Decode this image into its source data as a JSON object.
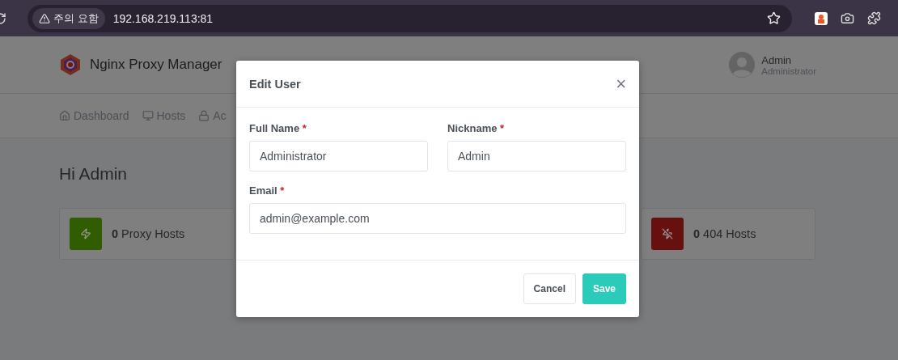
{
  "browser": {
    "security_chip": "주의 요함",
    "url": "192.168.219.113:81"
  },
  "header": {
    "brand": "Nginx Proxy Manager",
    "user": {
      "name": "Admin",
      "role": "Administrator"
    }
  },
  "nav": [
    {
      "label": "Dashboard"
    },
    {
      "label": "Hosts"
    },
    {
      "label": "Ac"
    }
  ],
  "greeting": "Hi Admin",
  "stats": [
    {
      "count": "0",
      "label": "Proxy Hosts",
      "color": "#2f5d00"
    },
    {
      "count": "0",
      "label": "404 Hosts",
      "color": "#671010"
    }
  ],
  "modal": {
    "title": "Edit User",
    "close": "×",
    "fields": [
      {
        "label": "Full Name",
        "required_mark": "*",
        "value": "Administrator"
      },
      {
        "label": "Nickname",
        "required_mark": "*",
        "value": "Admin"
      },
      {
        "label": "Email",
        "required_mark": "*",
        "value": "admin@example.com"
      }
    ],
    "buttons": [
      {
        "label": "Cancel",
        "kind": "secondary"
      },
      {
        "label": "Save",
        "kind": "primary"
      }
    ]
  }
}
